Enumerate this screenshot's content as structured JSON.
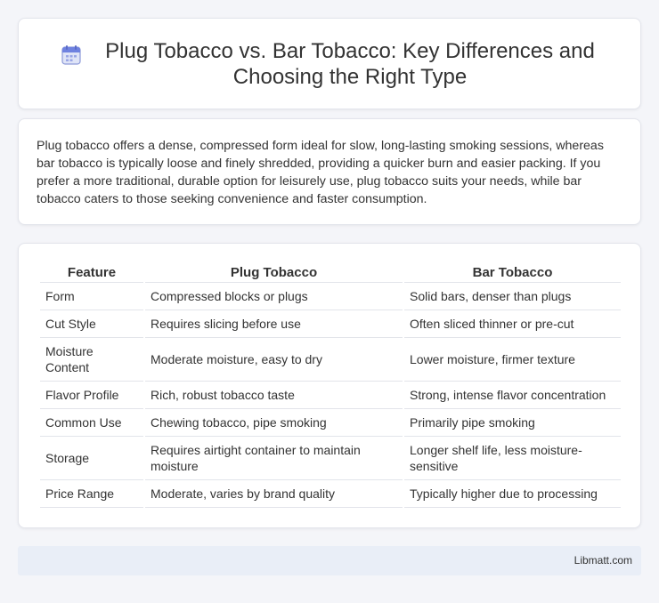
{
  "header": {
    "title": "Plug Tobacco vs. Bar Tobacco: Key Differences and Choosing the Right Type",
    "icon": "calendar-icon"
  },
  "intro": {
    "text": "Plug tobacco offers a dense, compressed form ideal for slow, long-lasting smoking sessions, whereas bar tobacco is typically loose and finely shredded, providing a quicker burn and easier packing. If you prefer a more traditional, durable option for leisurely use, plug tobacco suits your needs, while bar tobacco caters to those seeking convenience and faster consumption."
  },
  "table": {
    "headers": [
      "Feature",
      "Plug Tobacco",
      "Bar Tobacco"
    ],
    "rows": [
      [
        "Form",
        "Compressed blocks or plugs",
        "Solid bars, denser than plugs"
      ],
      [
        "Cut Style",
        "Requires slicing before use",
        "Often sliced thinner or pre-cut"
      ],
      [
        "Moisture Content",
        "Moderate moisture, easy to dry",
        "Lower moisture, firmer texture"
      ],
      [
        "Flavor Profile",
        "Rich, robust tobacco taste",
        "Strong, intense flavor concentration"
      ],
      [
        "Common Use",
        "Chewing tobacco, pipe smoking",
        "Primarily pipe smoking"
      ],
      [
        "Storage",
        "Requires airtight container to maintain moisture",
        "Longer shelf life, less moisture-sensitive"
      ],
      [
        "Price Range",
        "Moderate, varies by brand quality",
        "Typically higher due to processing"
      ]
    ]
  },
  "footer": {
    "text": "Libmatt.com"
  }
}
